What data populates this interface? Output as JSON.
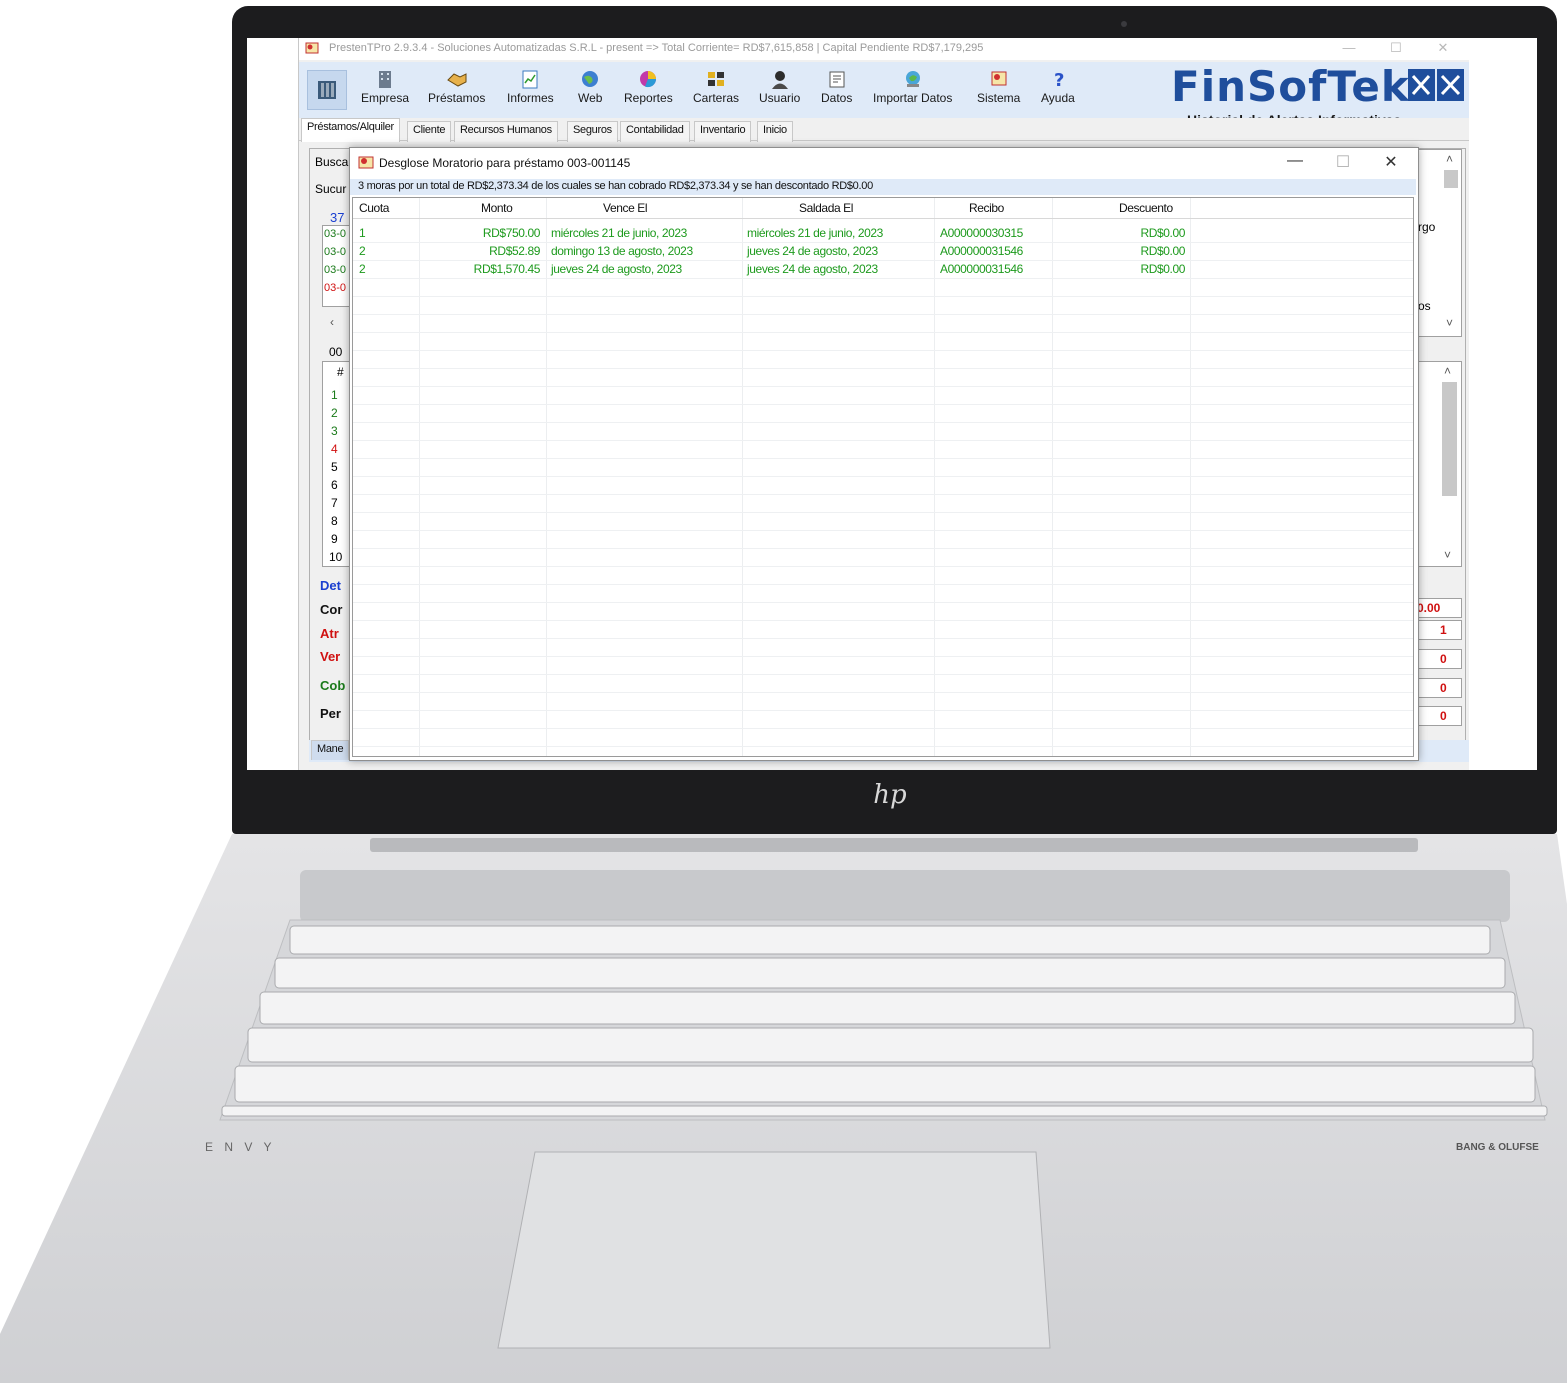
{
  "window": {
    "title": "PrestenTPro 2.9.3.4 - Soluciones Automatizadas S.R.L - present => Total Corriente= RD$7,615,858 | Capital Pendiente RD$7,179,295"
  },
  "ribbon": {
    "buttons": [
      {
        "label": "Empresa",
        "icon": "building-icon"
      },
      {
        "label": "Préstamos",
        "icon": "handshake-icon"
      },
      {
        "label": "Informes",
        "icon": "report-icon"
      },
      {
        "label": "Web",
        "icon": "globe-icon"
      },
      {
        "label": "Reportes",
        "icon": "chart-icon"
      },
      {
        "label": "Carteras",
        "icon": "portfolio-icon"
      },
      {
        "label": "Usuario",
        "icon": "user-icon"
      },
      {
        "label": "Datos",
        "icon": "data-icon"
      },
      {
        "label": "Importar Datos",
        "icon": "import-icon"
      },
      {
        "label": "Sistema",
        "icon": "system-icon"
      },
      {
        "label": "Ayuda",
        "icon": "help-icon"
      }
    ]
  },
  "brand": {
    "name": "FinSofTek",
    "subtitle": "Historial de Alertas Informativas",
    "color": "#1f4e9c"
  },
  "tabs": [
    "Préstamos/Alquiler",
    "Cliente",
    "Recursos Humanos",
    "Seguros",
    "Contabilidad",
    "Inventario",
    "Inicio"
  ],
  "background_panel": {
    "buscar_label": "Busca",
    "sucursal_label": "Sucur",
    "loan_number": "37",
    "loan_rows": [
      "03-0",
      "03-0",
      "03-0",
      "03-0"
    ],
    "loan_row_colors": [
      "#1a7a1a",
      "#1a7a1a",
      "#1a7a1a",
      "#d01010"
    ],
    "field_code": "00",
    "list_header": "#",
    "list_items": [
      "1",
      "2",
      "3",
      "4",
      "5",
      "6",
      "7",
      "8",
      "9",
      "10"
    ],
    "list_item_colors": [
      "#1a7a1a",
      "#1a7a1a",
      "#1a7a1a",
      "#d01010",
      "#111111",
      "#111111",
      "#111111",
      "#111111",
      "#111111",
      "#111111"
    ],
    "right_text_1": "rgo",
    "right_text_2": "os",
    "detail_labels": [
      {
        "text": "Det",
        "color": "#1a3fd0"
      },
      {
        "text": "Cor",
        "color": "#111111"
      },
      {
        "text": "Atr",
        "color": "#d01010"
      },
      {
        "text": "Ver",
        "color": "#d01010"
      },
      {
        "text": "Cob",
        "color": "#1a7a1a"
      },
      {
        "text": "Per",
        "color": "#111111"
      }
    ],
    "detail_values": [
      "0.00",
      "1",
      "0",
      "0",
      "0"
    ],
    "bottom_tab": "Mane"
  },
  "dialog": {
    "title": "Desglose Moratorio para préstamo 003-001145",
    "summary": "3 moras por un total de RD$2,373.34 de los cuales se han cobrado RD$2,373.34 y se han descontado RD$0.00",
    "columns": [
      "Cuota",
      "Monto",
      "Vence El",
      "Saldada El",
      "Recibo",
      "Descuento"
    ],
    "rows": [
      {
        "cuota": "1",
        "monto": "RD$750.00",
        "vence": "miércoles 21 de junio, 2023",
        "saldada": "miércoles 21 de junio, 2023",
        "recibo": "A000000030315",
        "descuento": "RD$0.00"
      },
      {
        "cuota": "2",
        "monto": "RD$52.89",
        "vence": "domingo 13 de agosto, 2023",
        "saldada": "jueves 24 de agosto, 2023",
        "recibo": "A000000031546",
        "descuento": "RD$0.00"
      },
      {
        "cuota": "2",
        "monto": "RD$1,570.45",
        "vence": "jueves 24 de agosto, 2023",
        "saldada": "jueves 24 de agosto, 2023",
        "recibo": "A000000031546",
        "descuento": "RD$0.00"
      }
    ],
    "row_color": "#1d9a1d"
  },
  "laptop": {
    "brand_left": "E N V Y",
    "brand_right": "BANG & OLUFSE"
  }
}
